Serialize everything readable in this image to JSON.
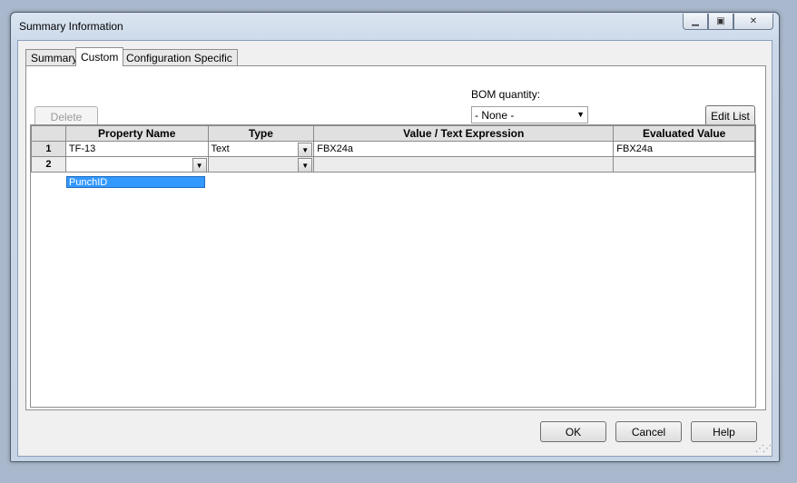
{
  "window": {
    "title": "Summary Information"
  },
  "tabs": [
    {
      "label": "Summary"
    },
    {
      "label": "Custom"
    },
    {
      "label": "Configuration Specific"
    }
  ],
  "toolbar": {
    "delete_label": "Delete",
    "bom_label": "BOM quantity:",
    "bom_value": "- None -",
    "edit_list_label": "Edit List"
  },
  "table": {
    "columns": [
      "Property Name",
      "Type",
      "Value / Text Expression",
      "Evaluated Value"
    ],
    "rows": [
      {
        "num": "1",
        "name": "TF-13",
        "type": "Text",
        "value": "FBX24a",
        "evaluated": "FBX24a"
      },
      {
        "num": "2",
        "name": "",
        "type": "",
        "value": "",
        "evaluated": ""
      }
    ],
    "suggestion": "PunchID"
  },
  "footer": {
    "ok_label": "OK",
    "cancel_label": "Cancel",
    "help_label": "Help"
  }
}
